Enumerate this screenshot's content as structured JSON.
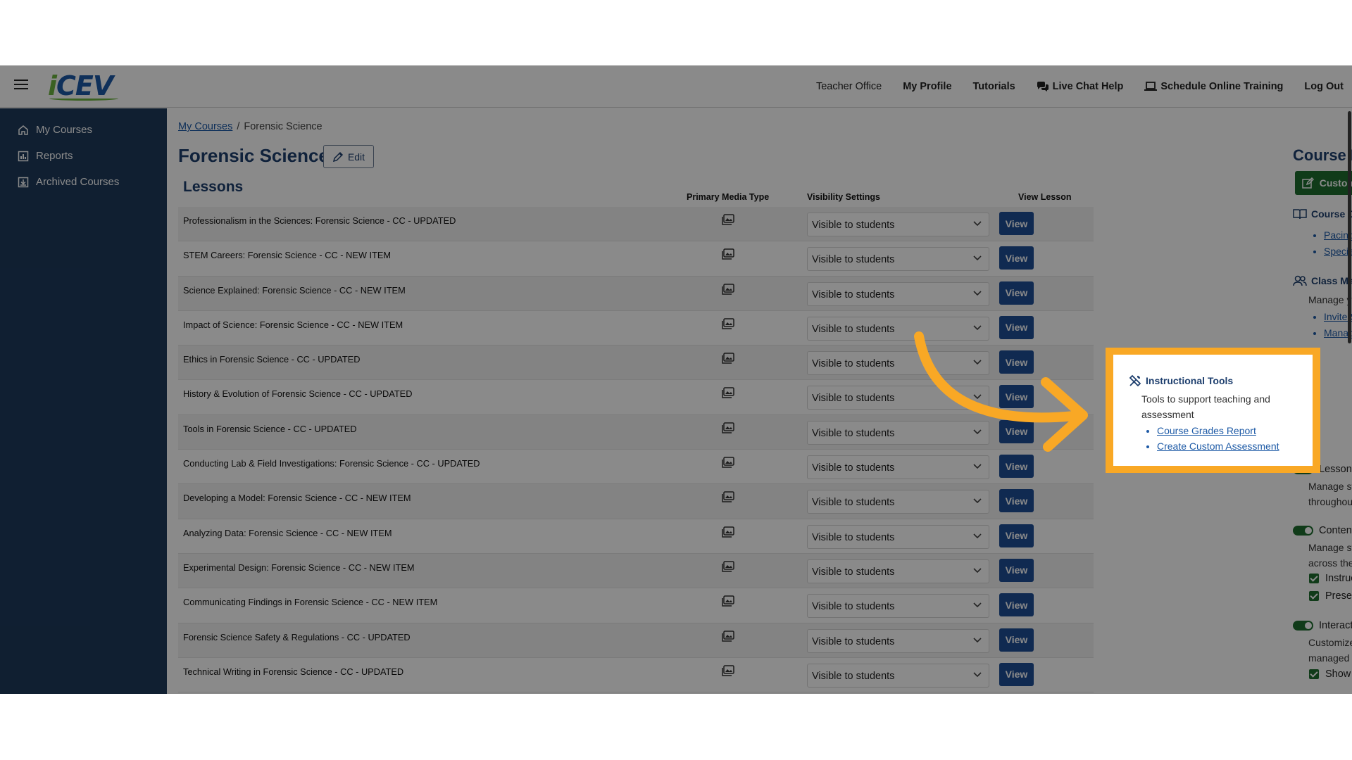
{
  "topnav": {
    "teacher_office": "Teacher Office",
    "my_profile": "My Profile",
    "tutorials": "Tutorials",
    "live_chat": "Live Chat Help",
    "schedule_training": "Schedule Online Training",
    "logout": "Log Out"
  },
  "logo": {
    "i": "i",
    "rest": "CEV"
  },
  "sidebar": {
    "items": [
      {
        "label": "My Courses",
        "icon": "home-icon"
      },
      {
        "label": "Reports",
        "icon": "reports-icon"
      },
      {
        "label": "Archived Courses",
        "icon": "archive-icon"
      }
    ]
  },
  "breadcrumb": {
    "root": "My Courses",
    "separator": "/",
    "current": "Forensic Science"
  },
  "course": {
    "title": "Forensic Science",
    "edit_label": "Edit"
  },
  "lessons": {
    "heading": "Lessons",
    "columns": {
      "media": "Primary Media Type",
      "visibility": "Visibility Settings",
      "view": "View Lesson"
    },
    "view_label": "View",
    "rows": [
      {
        "name": "Professionalism in the Sciences: Forensic Science - CC - UPDATED",
        "visibility": "Visible to students"
      },
      {
        "name": "STEM Careers: Forensic Science - CC - NEW ITEM",
        "visibility": "Visible to students"
      },
      {
        "name": "Science Explained: Forensic Science - CC - NEW ITEM",
        "visibility": "Visible to students"
      },
      {
        "name": "Impact of Science: Forensic Science - CC - NEW ITEM",
        "visibility": "Visible to students"
      },
      {
        "name": "Ethics in Forensic Science - CC - UPDATED",
        "visibility": "Visible to students"
      },
      {
        "name": "History & Evolution of Forensic Science - CC - UPDATED",
        "visibility": "Visible to students"
      },
      {
        "name": "Tools in Forensic Science - CC - UPDATED",
        "visibility": "Visible to students"
      },
      {
        "name": "Conducting Lab & Field Investigations: Forensic Science - CC - UPDATED",
        "visibility": "Visible to students"
      },
      {
        "name": "Developing a Model: Forensic Science - CC - NEW ITEM",
        "visibility": "Visible to students"
      },
      {
        "name": "Analyzing Data: Forensic Science - CC - NEW ITEM",
        "visibility": "Visible to students"
      },
      {
        "name": "Experimental Design: Forensic Science - CC - NEW ITEM",
        "visibility": "Visible to students"
      },
      {
        "name": "Communicating Findings in Forensic Science - CC - NEW ITEM",
        "visibility": "Visible to students"
      },
      {
        "name": "Forensic Science Safety & Regulations - CC - UPDATED",
        "visibility": "Visible to students"
      },
      {
        "name": "Technical Writing in Forensic Science - CC - UPDATED",
        "visibility": "Visible to students"
      }
    ]
  },
  "cmm": {
    "title": "Course Management Menu",
    "customize_label": "Customize This Course",
    "course_guides": {
      "heading": "Course Guides",
      "links": [
        "Pacing Guide",
        "Special Population Strategies"
      ]
    },
    "class_management": {
      "heading": "Class Management",
      "description": "Manage your students and teaching team",
      "links": [
        "Invite Students",
        "Manage Roster"
      ]
    },
    "instructional_tools": {
      "heading": "Instructional Tools",
      "description": "Tools to support teaching and assessment",
      "links": [
        "Course Grades Report",
        "Create Custom Assessment"
      ]
    },
    "lesson_visibility": {
      "label": "Lesson Visibility",
      "description": "Manage student access to lessons throughout the course"
    },
    "content_controls": {
      "label": "Content Controls",
      "description": "Manage student access to lesson content across the course",
      "checks": [
        "Instructional Materials",
        "Presentation Media"
      ]
    },
    "interactive_assignments": {
      "label": "Interactive Assignments",
      "description": "Customize how interactive assignments are managed throughout the course",
      "checks": [
        "Show in Grade Reports"
      ]
    }
  },
  "colors": {
    "brand_navy": "#1e3a5c",
    "primary_blue": "#1f4f97",
    "success_green": "#1f6e2f",
    "highlight_orange": "#f9a825"
  }
}
